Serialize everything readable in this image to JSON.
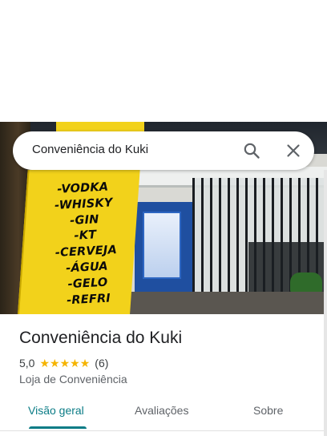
{
  "search": {
    "query": "Conveniência do Kuki",
    "search_icon": "search-icon",
    "close_icon": "close-icon"
  },
  "photo": {
    "flag_words": [
      "-VODKA",
      "-WHISKY",
      "-GIN",
      "-KT",
      "-CERVEJA",
      "-ÁGUA",
      "-GELO",
      "-REFRI"
    ],
    "colors": {
      "flag": "#f2d21b",
      "storefront": "#1f4fa0"
    }
  },
  "place": {
    "name": "Conveniência do Kuki",
    "rating": "5,0",
    "stars": 5,
    "reviews": "(6)",
    "category": "Loja de Conveniência"
  },
  "tabs": [
    {
      "label": "Visão geral",
      "active": true
    },
    {
      "label": "Avaliações",
      "active": false
    },
    {
      "label": "Sobre",
      "active": false
    }
  ],
  "colors": {
    "accent": "#0b7c86",
    "star": "#f5b400"
  }
}
